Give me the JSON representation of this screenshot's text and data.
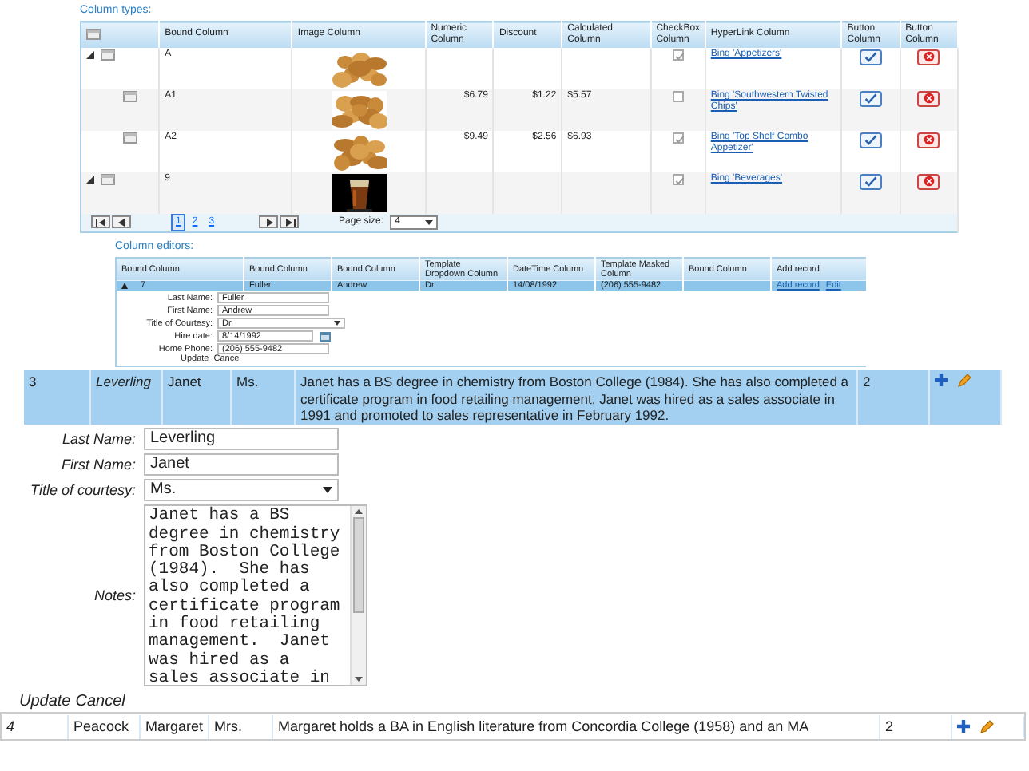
{
  "column_types": {
    "heading": "Column types:",
    "columns": [
      "Bound Column",
      "Image Column",
      "Numeric Column",
      "Discount",
      "Calculated Column",
      "CheckBox Column",
      "HyperLink Column",
      "Button Column",
      "Button Column"
    ],
    "rows": [
      {
        "name": "A",
        "image": {
          "kind": "picture"
        },
        "checked": true,
        "link": "Bing 'Appetizers'",
        "expanded": true,
        "children": [
          {
            "name": "A1",
            "image": {
              "kind": "picture"
            },
            "numeric": "$6.79",
            "discount": "$1.22",
            "calculated": "$5.57",
            "checked": false,
            "link": "Bing 'Southwestern Twisted Chips'"
          },
          {
            "name": "A2",
            "image": {
              "kind": "picture"
            },
            "numeric": "$9.49",
            "discount": "$2.56",
            "calculated": "$6.93",
            "checked": true,
            "link": "Bing 'Top Shelf Combo Appetizer'"
          }
        ]
      },
      {
        "name": "9",
        "image": {
          "kind": "picture"
        },
        "checked": true,
        "link": "Bing 'Beverages'",
        "expanded": true
      }
    ],
    "pager": {
      "pages": [
        {
          "label": "1",
          "selected": true
        },
        {
          "label": "2",
          "selected": false
        },
        {
          "label": "3",
          "selected": false
        }
      ],
      "page_size_label": "Page size:",
      "page_size": "4"
    }
  },
  "column_editors": {
    "heading": "Column editors:",
    "columns": [
      "Bound Column",
      "Bound Column",
      "Bound Column",
      "Template Dropdown Column",
      "DateTime Column",
      "Template Masked Column",
      "Bound Column",
      "Add record"
    ],
    "rows": [
      {
        "cells": [
          "7",
          "Fuller",
          "Andrew",
          "Dr.",
          "14/08/1992",
          "(206) 555-9482",
          null
        ],
        "links": [
          "Add record",
          "Edit"
        ],
        "expanded": true,
        "selected": true,
        "edit_form": {
          "fields": [
            {
              "label": "Last Name:",
              "value": "Fuller",
              "kind": "text"
            },
            {
              "label": "First Name:",
              "value": "Andrew",
              "kind": "text"
            },
            {
              "label": "Title of Courtesy:",
              "value": "Dr.",
              "kind": "select"
            },
            {
              "label": "Hire date:",
              "value": "8/14/1992",
              "kind": "date"
            },
            {
              "label": "Home Phone:",
              "value": "(206) 555-9482",
              "kind": "text"
            }
          ],
          "actions": [
            "Update",
            "Cancel"
          ]
        }
      }
    ]
  },
  "employees": {
    "rows": [
      {
        "id": "3",
        "last_name": "Leverling",
        "first_name": "Janet",
        "title": "Ms.",
        "notes": "Janet has a BS degree in chemistry from Boston College (1984). She has also completed a certificate program in food retailing management. Janet was hired as a sales associate in 1991 and promoted to sales representative in February 1992.",
        "count": "2",
        "selected": true,
        "edit_form": {
          "fields": [
            {
              "label": "Last Name:",
              "value": "Leverling",
              "kind": "text"
            },
            {
              "label": "First Name:",
              "value": "Janet",
              "kind": "text"
            },
            {
              "label": "Title of courtesy:",
              "value": "Ms.",
              "kind": "select"
            },
            {
              "label": "Notes:",
              "value": "Janet has a BS degree in chemistry from Boston College (1984).  She has also completed a certificate program in food retailing management.  Janet was hired as a sales associate in",
              "kind": "textarea"
            }
          ],
          "actions": [
            "Update",
            "Cancel"
          ]
        }
      },
      {
        "id": "4",
        "last_name": "Peacock",
        "first_name": "Margaret",
        "title": "Mrs.",
        "notes": "Margaret holds a BA in English literature from Concordia College (1958) and an MA",
        "count": "2",
        "selected": false
      }
    ]
  }
}
